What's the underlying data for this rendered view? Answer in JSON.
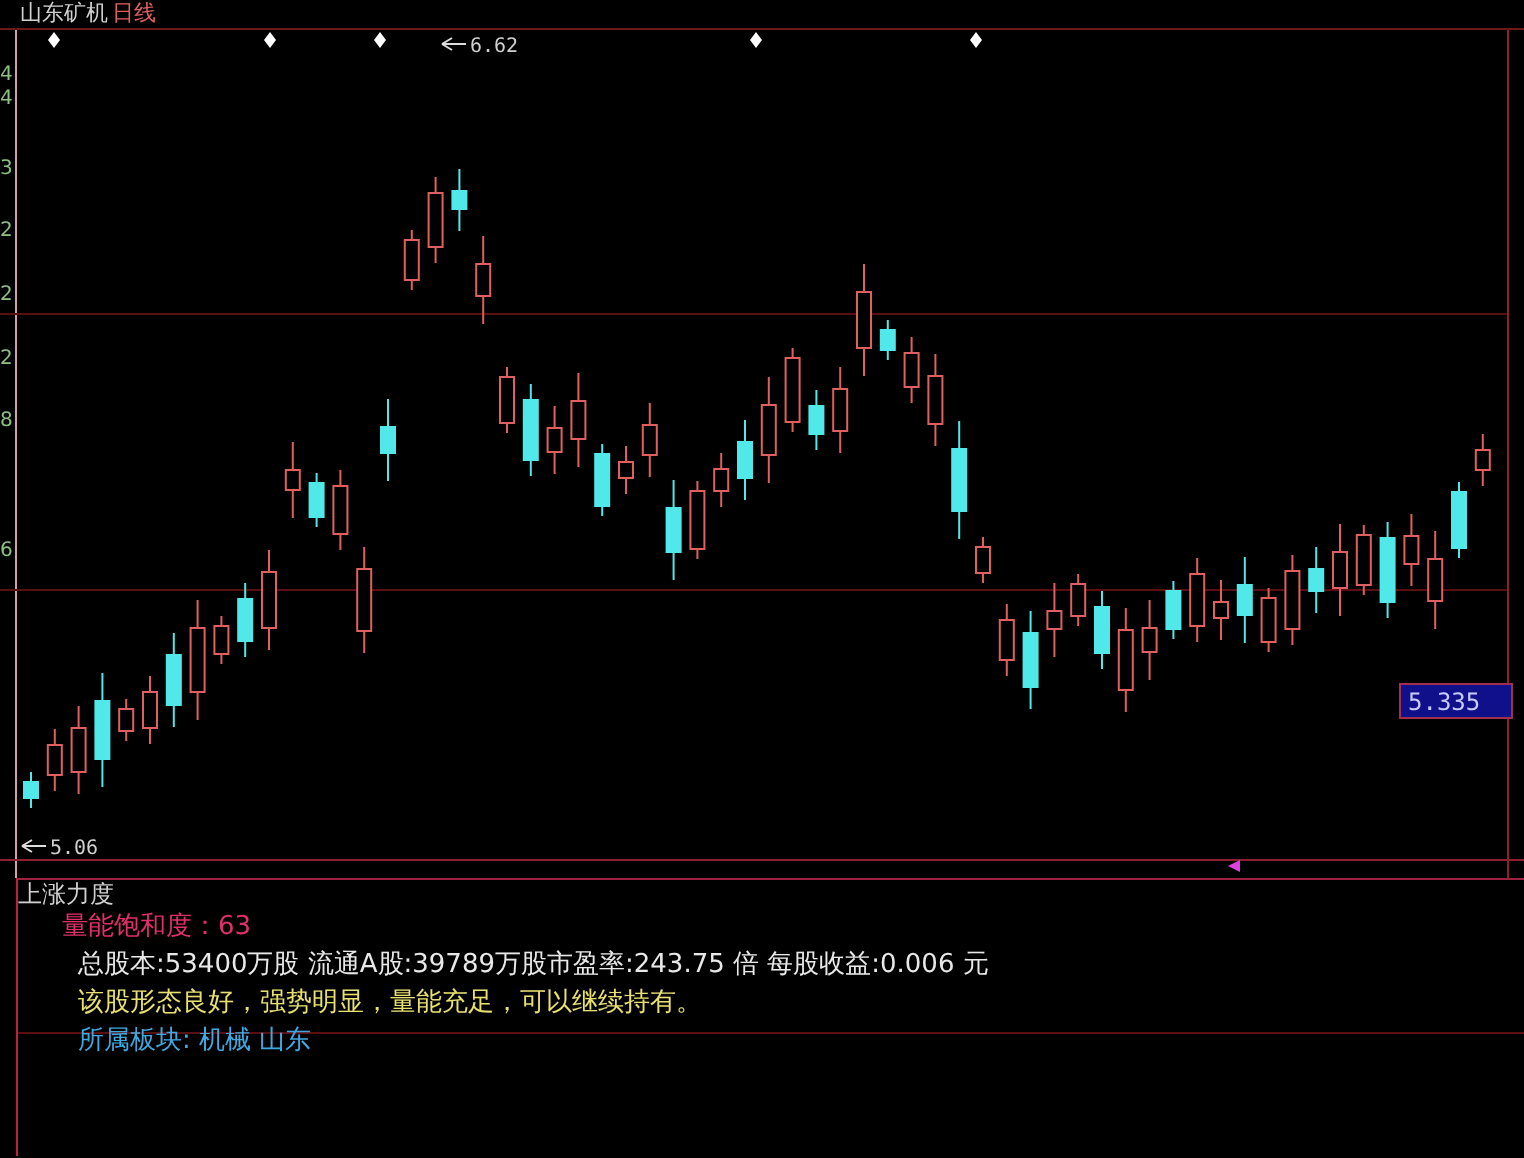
{
  "chart": {
    "stock_name": "山东矿机",
    "period": "日线",
    "axis_labels": [
      "4",
      "4",
      "3",
      "2",
      "2",
      "2",
      "8",
      "6"
    ],
    "high_label": "6.62",
    "low_label": "5.06",
    "price_tag": "5.335"
  },
  "indicator": {
    "title": "上涨力度",
    "lines": [
      {
        "kind": "saturation",
        "text": "量能饱和度：63"
      },
      {
        "kind": "info",
        "text": "总股本:53400万股 流通A股:39789万股市盈率:243.75 倍 每股收益:0.006 元"
      },
      {
        "kind": "advice",
        "text": "该股形态良好，强势明显，量能充足，可以继续持有。"
      },
      {
        "kind": "sector",
        "text": "所属板块: 机械 山东"
      }
    ]
  }
}
